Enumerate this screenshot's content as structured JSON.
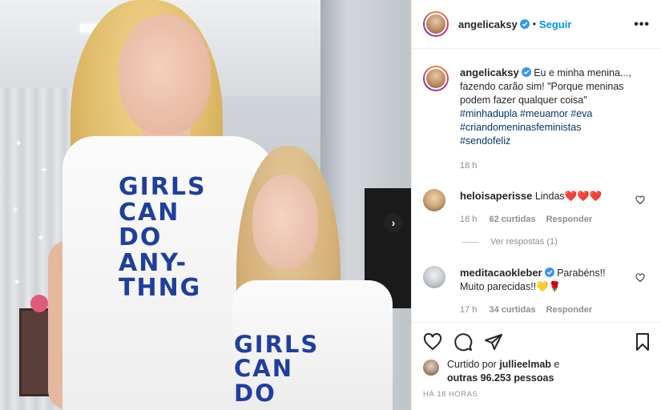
{
  "post": {
    "author": "angelicaksy",
    "follow_label": "Seguir",
    "separator": "•",
    "more_label": "•••",
    "next_label": "›"
  },
  "photo": {
    "shirt_text_woman": "GIRLS\nCAN\nDO\nANY-\nTHNG",
    "shirt_text_girl": "GIRLS\nCAN\nDO"
  },
  "caption": {
    "username": "angelicaksy",
    "text": "Eu e minha menina..., fazendo carão sim! \"Porque meninas podem fazer qualquer coisa\"",
    "hashtags": [
      "#minhadupla #meuamor #eva",
      "#criandomeninasfeministas",
      "#sendofeliz"
    ],
    "time": "18 h"
  },
  "comments": [
    {
      "username": "heloisaperisse",
      "text": "Lindas❤️❤️❤️",
      "time": "18 h",
      "likes": "62 curtidas",
      "reply_label": "Responder"
    },
    {
      "username": "meditacaokleber",
      "text": "Parabéns!! Muito parecidas!!💛🌹",
      "time": "17 h",
      "likes": "34 curtidas",
      "reply_label": "Responder"
    }
  ],
  "view_replies": "Ver respostas (1)",
  "likes": {
    "prefix": "Curtido por",
    "user": "jullieelmab",
    "connector": "e",
    "others": "outras 96.253 pessoas"
  },
  "time_ago": "HÁ 18 HORAS",
  "colors": {
    "accent_blue": "#0095f6",
    "hashtag": "#00376b",
    "muted": "#8e8e8e",
    "shirt_print": "#1f3f9e"
  },
  "icons": [
    "verified-badge-icon",
    "more-options-icon",
    "heart-icon",
    "comment-icon",
    "share-icon",
    "bookmark-icon",
    "next-arrow-icon"
  ]
}
